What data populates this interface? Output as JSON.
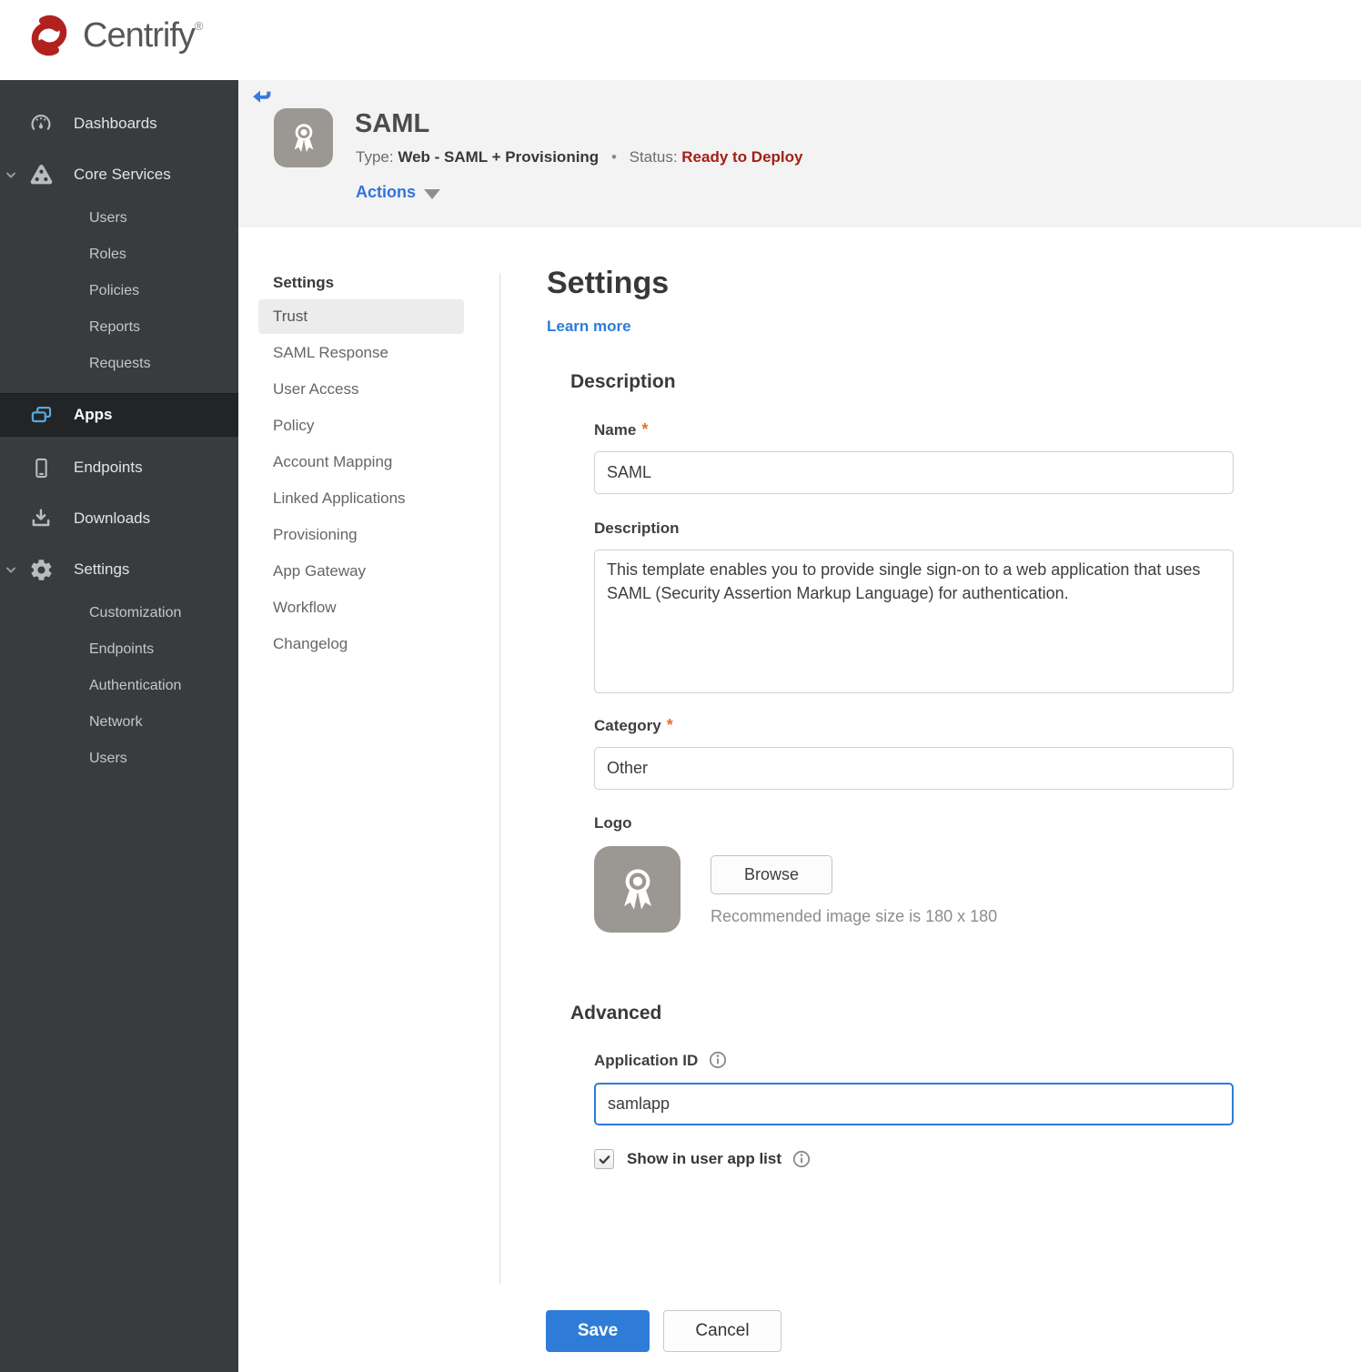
{
  "brand": {
    "name": "Centrify",
    "registered": "®"
  },
  "colors": {
    "accent_blue": "#2e7cd8",
    "link_blue": "#2f7bd9",
    "status_red": "#a32016",
    "apps_icon_blue": "#55a8e1",
    "brand_red": "#b1221f",
    "sidebar_bg": "#3a3b3d",
    "sidebar_selected_bg": "#232426"
  },
  "sidebar": {
    "items": [
      {
        "label": "Dashboards",
        "icon": "gauge-icon"
      },
      {
        "label": "Core Services",
        "icon": "core-services-icon",
        "expanded": true,
        "children": [
          "Users",
          "Roles",
          "Policies",
          "Reports",
          "Requests"
        ]
      },
      {
        "label": "Apps",
        "icon": "apps-icon",
        "selected": true
      },
      {
        "label": "Endpoints",
        "icon": "mobile-icon"
      },
      {
        "label": "Downloads",
        "icon": "download-icon"
      },
      {
        "label": "Settings",
        "icon": "gear-icon",
        "expanded": true,
        "children": [
          "Customization",
          "Endpoints",
          "Authentication",
          "Network",
          "Users"
        ]
      }
    ]
  },
  "app_header": {
    "title": "SAML",
    "type_label": "Type:",
    "type_value": "Web - SAML + Provisioning",
    "separator": "•",
    "status_label": "Status:",
    "status_value": "Ready to Deploy",
    "actions_label": "Actions"
  },
  "subnav": {
    "header": "Settings",
    "items": [
      {
        "label": "Trust",
        "selected": true
      },
      {
        "label": "SAML Response",
        "selected": false
      },
      {
        "label": "User Access",
        "selected": false
      },
      {
        "label": "Policy",
        "selected": false
      },
      {
        "label": "Account Mapping",
        "selected": false
      },
      {
        "label": "Linked Applications",
        "selected": false
      },
      {
        "label": "Provisioning",
        "selected": false
      },
      {
        "label": "App Gateway",
        "selected": false
      },
      {
        "label": "Workflow",
        "selected": false
      },
      {
        "label": "Changelog",
        "selected": false
      }
    ]
  },
  "main": {
    "title": "Settings",
    "learn_more": "Learn more",
    "description_section": {
      "heading": "Description",
      "name_label": "Name",
      "name_required": "*",
      "name_value": "SAML",
      "description_label": "Description",
      "description_value": "This template enables you to provide single sign-on to a web application that uses SAML (Security Assertion Markup Language) for authentication.",
      "category_label": "Category",
      "category_required": "*",
      "category_value": "Other",
      "logo_label": "Logo",
      "browse_label": "Browse",
      "logo_hint": "Recommended image size is 180 x 180"
    },
    "advanced_section": {
      "heading": "Advanced",
      "app_id_label": "Application ID",
      "app_id_value": "samlapp",
      "show_label": "Show in user app list",
      "show_checked": true
    },
    "footer": {
      "save_label": "Save",
      "cancel_label": "Cancel"
    }
  }
}
